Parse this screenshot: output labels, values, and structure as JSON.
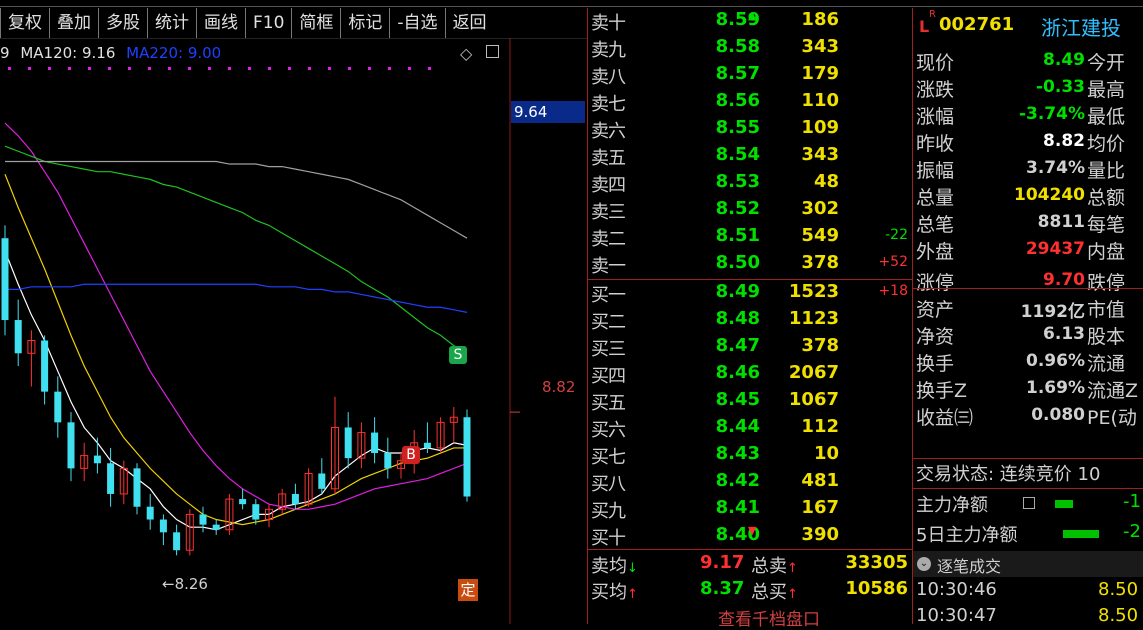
{
  "toolbar": [
    "复权",
    "叠加",
    "多股",
    "统计",
    "画线",
    "F10",
    "简框",
    "标记",
    "-自选",
    "返回"
  ],
  "ma_legend": {
    "ma_prefix": "9",
    "ma120": "MA120: 9.16",
    "ma220": "MA220: 9.00"
  },
  "chart": {
    "price_tag": "9.64",
    "ref_price": "8.82",
    "low_mark": "←8.26",
    "ding": "定",
    "s_badge": "S",
    "b_badge": "B"
  },
  "sell_orders": [
    {
      "label": "卖十",
      "price": "8.59",
      "vol": "186",
      "chg": "",
      "arrow": "up"
    },
    {
      "label": "卖九",
      "price": "8.58",
      "vol": "343",
      "chg": ""
    },
    {
      "label": "卖八",
      "price": "8.57",
      "vol": "179",
      "chg": ""
    },
    {
      "label": "卖七",
      "price": "8.56",
      "vol": "110",
      "chg": ""
    },
    {
      "label": "卖六",
      "price": "8.55",
      "vol": "109",
      "chg": ""
    },
    {
      "label": "卖五",
      "price": "8.54",
      "vol": "343",
      "chg": ""
    },
    {
      "label": "卖四",
      "price": "8.53",
      "vol": "48",
      "chg": ""
    },
    {
      "label": "卖三",
      "price": "8.52",
      "vol": "302",
      "chg": ""
    },
    {
      "label": "卖二",
      "price": "8.51",
      "vol": "549",
      "chg": "-22"
    },
    {
      "label": "卖一",
      "price": "8.50",
      "vol": "378",
      "chg": "+52"
    }
  ],
  "buy_orders": [
    {
      "label": "买一",
      "price": "8.49",
      "vol": "1523",
      "chg": "+18"
    },
    {
      "label": "买二",
      "price": "8.48",
      "vol": "1123",
      "chg": ""
    },
    {
      "label": "买三",
      "price": "8.47",
      "vol": "378",
      "chg": ""
    },
    {
      "label": "买四",
      "price": "8.46",
      "vol": "2067",
      "chg": ""
    },
    {
      "label": "买五",
      "price": "8.45",
      "vol": "1067",
      "chg": ""
    },
    {
      "label": "买六",
      "price": "8.44",
      "vol": "112",
      "chg": ""
    },
    {
      "label": "买七",
      "price": "8.43",
      "vol": "10",
      "chg": ""
    },
    {
      "label": "买八",
      "price": "8.42",
      "vol": "481",
      "chg": ""
    },
    {
      "label": "买九",
      "price": "8.41",
      "vol": "167",
      "chg": ""
    },
    {
      "label": "买十",
      "price": "8.40",
      "vol": "390",
      "chg": "",
      "arrow": "down"
    }
  ],
  "averages": [
    {
      "label": "卖均",
      "price": "9.17",
      "label2": "总卖",
      "vol": "33305",
      "color": "#ff3030"
    },
    {
      "label": "买均",
      "price": "8.37",
      "label2": "总买",
      "vol": "10586",
      "color": "#00e000"
    }
  ],
  "view_more": "查看千档盘口",
  "stock": {
    "lr": "L",
    "rsup": "R",
    "code": "002761",
    "name": "浙江建投"
  },
  "quote_rows": [
    {
      "k": "现价",
      "v": "8.49",
      "color": "#00e000",
      "k2": "今开"
    },
    {
      "k": "涨跌",
      "v": "-0.33",
      "color": "#00e000",
      "k2": "最高"
    },
    {
      "k": "涨幅",
      "v": "-3.74%",
      "color": "#00e000",
      "k2": "最低"
    },
    {
      "k": "昨收",
      "v": "8.82",
      "color": "#ffffff",
      "k2": "均价"
    },
    {
      "k": "振幅",
      "v": "3.74%",
      "color": "#d0d0d0",
      "k2": "量比"
    },
    {
      "k": "总量",
      "v": "104240",
      "color": "#f0e000",
      "k2": "总额"
    },
    {
      "k": "总笔",
      "v": "8811",
      "color": "#d0d0d0",
      "k2": "每笔"
    },
    {
      "k": "外盘",
      "v": "29437",
      "color": "#ff3030",
      "k2": "内盘"
    },
    {
      "k": "涨停",
      "v": "9.70",
      "color": "#ff3030",
      "k2": "跌停"
    },
    {
      "k": "资产",
      "v": "1192亿",
      "color": "#d0d0d0",
      "k2": "市值"
    },
    {
      "k": "净资",
      "v": "6.13",
      "color": "#d0d0d0",
      "k2": "股本"
    },
    {
      "k": "换手",
      "v": "0.96%",
      "color": "#d0d0d0",
      "k2": "流通"
    },
    {
      "k": "换手Z",
      "v": "1.69%",
      "color": "#d0d0d0",
      "k2": "流通Z"
    },
    {
      "k": "收益㈢",
      "v": "0.080",
      "color": "#d0d0d0",
      "k2": "PE(动"
    }
  ],
  "trade_state": "交易状态: 连续竞价 10",
  "flows": [
    {
      "label": "主力净额",
      "val": "-1"
    },
    {
      "label": "5日主力净额",
      "val": "-2"
    }
  ],
  "ticks_header": "逐笔成交",
  "ticks": [
    {
      "time": "10:30:46",
      "price": "8.50"
    },
    {
      "time": "10:30:47",
      "price": "8.50"
    }
  ],
  "candles": [
    {
      "o": 9.5,
      "h": 9.55,
      "l": 9.12,
      "c": 9.18
    },
    {
      "o": 9.18,
      "h": 9.26,
      "l": 9.0,
      "c": 9.05
    },
    {
      "o": 9.05,
      "h": 9.14,
      "l": 8.92,
      "c": 9.1
    },
    {
      "o": 9.1,
      "h": 9.12,
      "l": 8.85,
      "c": 8.9
    },
    {
      "o": 8.9,
      "h": 8.96,
      "l": 8.72,
      "c": 8.78
    },
    {
      "o": 8.78,
      "h": 8.82,
      "l": 8.55,
      "c": 8.6
    },
    {
      "o": 8.6,
      "h": 8.7,
      "l": 8.55,
      "c": 8.65
    },
    {
      "o": 8.65,
      "h": 8.72,
      "l": 8.58,
      "c": 8.62
    },
    {
      "o": 8.62,
      "h": 8.68,
      "l": 8.45,
      "c": 8.5
    },
    {
      "o": 8.5,
      "h": 8.63,
      "l": 8.46,
      "c": 8.6
    },
    {
      "o": 8.6,
      "h": 8.62,
      "l": 8.42,
      "c": 8.45
    },
    {
      "o": 8.45,
      "h": 8.5,
      "l": 8.36,
      "c": 8.4
    },
    {
      "o": 8.4,
      "h": 8.42,
      "l": 8.3,
      "c": 8.35
    },
    {
      "o": 8.35,
      "h": 8.38,
      "l": 8.26,
      "c": 8.28
    },
    {
      "o": 8.28,
      "h": 8.44,
      "l": 8.26,
      "c": 8.42
    },
    {
      "o": 8.42,
      "h": 8.45,
      "l": 8.35,
      "c": 8.38
    },
    {
      "o": 8.38,
      "h": 8.4,
      "l": 8.34,
      "c": 8.36
    },
    {
      "o": 8.36,
      "h": 8.5,
      "l": 8.34,
      "c": 8.48
    },
    {
      "o": 8.48,
      "h": 8.52,
      "l": 8.44,
      "c": 8.46
    },
    {
      "o": 8.46,
      "h": 8.48,
      "l": 8.38,
      "c": 8.4
    },
    {
      "o": 8.4,
      "h": 8.46,
      "l": 8.37,
      "c": 8.44
    },
    {
      "o": 8.44,
      "h": 8.52,
      "l": 8.42,
      "c": 8.5
    },
    {
      "o": 8.5,
      "h": 8.54,
      "l": 8.44,
      "c": 8.46
    },
    {
      "o": 8.46,
      "h": 8.6,
      "l": 8.45,
      "c": 8.58
    },
    {
      "o": 8.58,
      "h": 8.64,
      "l": 8.5,
      "c": 8.52
    },
    {
      "o": 8.52,
      "h": 8.88,
      "l": 8.5,
      "c": 8.76
    },
    {
      "o": 8.76,
      "h": 8.82,
      "l": 8.6,
      "c": 8.64
    },
    {
      "o": 8.64,
      "h": 8.78,
      "l": 8.6,
      "c": 8.74
    },
    {
      "o": 8.74,
      "h": 8.8,
      "l": 8.62,
      "c": 8.66
    },
    {
      "o": 8.66,
      "h": 8.72,
      "l": 8.56,
      "c": 8.6
    },
    {
      "o": 8.6,
      "h": 8.66,
      "l": 8.56,
      "c": 8.63
    },
    {
      "o": 8.63,
      "h": 8.75,
      "l": 8.58,
      "c": 8.7
    },
    {
      "o": 8.7,
      "h": 8.78,
      "l": 8.66,
      "c": 8.68
    },
    {
      "o": 8.68,
      "h": 8.8,
      "l": 8.66,
      "c": 8.78
    },
    {
      "o": 8.78,
      "h": 8.84,
      "l": 8.7,
      "c": 8.8
    },
    {
      "o": 8.8,
      "h": 8.83,
      "l": 8.47,
      "c": 8.49
    }
  ],
  "ma_series": [
    {
      "name": "MA5",
      "color": "#ffffff",
      "values": [
        9.45,
        9.32,
        9.2,
        9.1,
        8.98,
        8.86,
        8.76,
        8.7,
        8.63,
        8.6,
        8.56,
        8.52,
        8.45,
        8.4,
        8.37,
        8.37,
        8.36,
        8.38,
        8.4,
        8.42,
        8.42,
        8.45,
        8.46,
        8.47,
        8.5,
        8.57,
        8.61,
        8.65,
        8.68,
        8.66,
        8.66,
        8.67,
        8.68,
        8.67,
        8.7,
        8.69
      ]
    },
    {
      "name": "MA10",
      "color": "#f0d000",
      "values": [
        9.75,
        9.62,
        9.5,
        9.38,
        9.25,
        9.12,
        9.0,
        8.9,
        8.8,
        8.72,
        8.66,
        8.6,
        8.55,
        8.5,
        8.46,
        8.42,
        8.4,
        8.39,
        8.38,
        8.39,
        8.4,
        8.42,
        8.44,
        8.46,
        8.48,
        8.5,
        8.53,
        8.56,
        8.58,
        8.6,
        8.62,
        8.63,
        8.64,
        8.66,
        8.68,
        8.68
      ]
    },
    {
      "name": "MA20",
      "color": "#e020e0",
      "values": [
        9.95,
        9.9,
        9.84,
        9.76,
        9.68,
        9.58,
        9.48,
        9.38,
        9.28,
        9.18,
        9.08,
        8.98,
        8.9,
        8.82,
        8.74,
        8.67,
        8.61,
        8.56,
        8.52,
        8.49,
        8.46,
        8.45,
        8.44,
        8.44,
        8.45,
        8.46,
        8.48,
        8.5,
        8.52,
        8.53,
        8.54,
        8.55,
        8.56,
        8.58,
        8.6,
        8.62
      ]
    },
    {
      "name": "MA60",
      "color": "#20c020",
      "values": [
        9.86,
        9.84,
        9.82,
        9.8,
        9.79,
        9.78,
        9.77,
        9.76,
        9.76,
        9.75,
        9.74,
        9.73,
        9.71,
        9.7,
        9.68,
        9.66,
        9.64,
        9.62,
        9.6,
        9.57,
        9.55,
        9.52,
        9.49,
        9.46,
        9.43,
        9.4,
        9.37,
        9.33,
        9.3,
        9.27,
        9.23,
        9.19,
        9.15,
        9.12,
        9.08,
        9.05
      ]
    },
    {
      "name": "MA220",
      "color": "#2040ff",
      "values": [
        9.3,
        9.3,
        9.31,
        9.31,
        9.31,
        9.31,
        9.32,
        9.32,
        9.32,
        9.32,
        9.32,
        9.32,
        9.32,
        9.32,
        9.32,
        9.32,
        9.32,
        9.32,
        9.32,
        9.32,
        9.31,
        9.31,
        9.31,
        9.3,
        9.3,
        9.29,
        9.29,
        9.28,
        9.27,
        9.26,
        9.25,
        9.24,
        9.23,
        9.23,
        9.22,
        9.21
      ]
    },
    {
      "name": "MA120",
      "color": "#a0a0a0",
      "values": [
        9.8,
        9.8,
        9.8,
        9.8,
        9.8,
        9.8,
        9.8,
        9.8,
        9.8,
        9.8,
        9.8,
        9.8,
        9.8,
        9.8,
        9.8,
        9.8,
        9.8,
        9.79,
        9.79,
        9.79,
        9.78,
        9.78,
        9.77,
        9.76,
        9.75,
        9.74,
        9.73,
        9.71,
        9.69,
        9.67,
        9.65,
        9.62,
        9.59,
        9.56,
        9.53,
        9.5
      ]
    }
  ]
}
